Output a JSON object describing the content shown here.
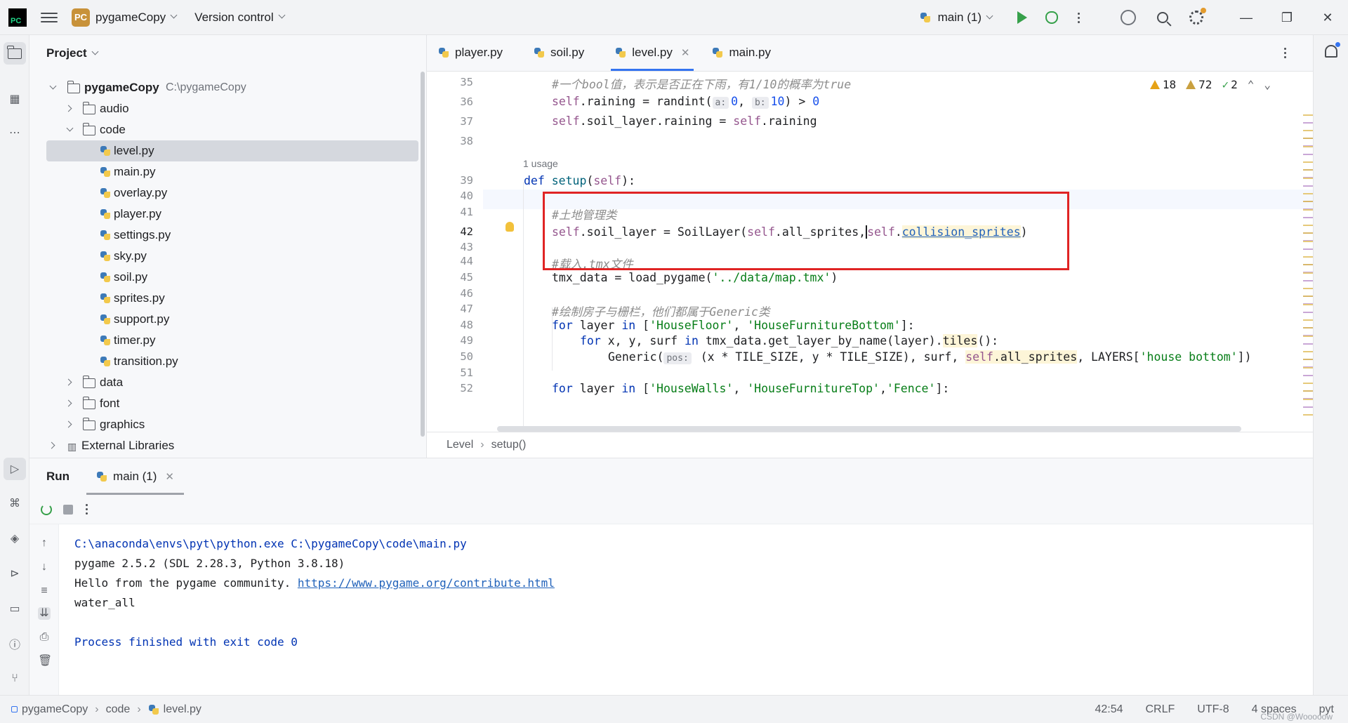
{
  "titlebar": {
    "project_badge": "PC",
    "project_name": "pygameCopy",
    "vcs": "Version control",
    "run_config": "main (1)"
  },
  "project_panel": {
    "title": "Project",
    "root": "pygameCopy",
    "root_path": "C:\\pygameCopy",
    "folders": [
      "audio",
      "code",
      "data",
      "font",
      "graphics"
    ],
    "code_files": [
      "level.py",
      "main.py",
      "overlay.py",
      "player.py",
      "settings.py",
      "sky.py",
      "soil.py",
      "sprites.py",
      "support.py",
      "timer.py",
      "transition.py"
    ],
    "external": "External Libraries"
  },
  "editor": {
    "tabs": [
      "player.py",
      "soil.py",
      "level.py",
      "main.py"
    ],
    "active_tab": "level.py",
    "inspections": {
      "warnings": "18",
      "weak_warnings": "72",
      "ok": "2"
    },
    "usage_hint": "1 usage",
    "line_numbers": [
      "35",
      "36",
      "37",
      "38",
      "39",
      "40",
      "41",
      "42",
      "43",
      "44",
      "45",
      "46",
      "47",
      "48",
      "49",
      "50",
      "51",
      "52"
    ],
    "code": {
      "l35": "#一个bool值，表示是否正在下雨，有1/10的概率为true",
      "l36_a": "self",
      "l36_b": ".raining = randint(",
      "l36_h1": "a:",
      "l36_n1": "0",
      "l36_c": ", ",
      "l36_h2": "b:",
      "l36_n2": "10",
      "l36_d": ") > ",
      "l36_n3": "0",
      "l37_a": "self",
      "l37_b": ".soil_layer.raining = ",
      "l37_c": "self",
      "l37_d": ".raining",
      "l39_kw": "def ",
      "l39_fn": "setup",
      "l39_p": "(",
      "l39_self": "self",
      "l39_e": "):",
      "l41": "#土地管理类",
      "l42_a": "self",
      "l42_b": ".soil_layer = SoilLayer(",
      "l42_c": "self",
      "l42_d": ".all_sprites,",
      "l42_e": "self",
      "l42_f": ".",
      "l42_g": "collision_sprites",
      "l42_h": ")",
      "l44": "#载入.tmx文件",
      "l45_a": "tmx_data = load_pygame(",
      "l45_s": "'../data/map.tmx'",
      "l45_b": ")",
      "l47": "#绘制房子与栅栏，他们都属于Generic类",
      "l48_kw": "for ",
      "l48_a": "layer ",
      "l48_in": "in ",
      "l48_b": "[",
      "l48_s1": "'HouseFloor'",
      "l48_c": ", ",
      "l48_s2": "'HouseFurnitureBottom'",
      "l48_d": "]:",
      "l49_kw": "for ",
      "l49_a": "x, y, surf ",
      "l49_in": "in ",
      "l49_b": "tmx_data.get_layer_by_name(layer).",
      "l49_t": "tiles",
      "l49_c": "():",
      "l50_a": "Generic(",
      "l50_h": "pos:",
      "l50_b": " (x * TILE_SIZE, y * TILE_SIZE), surf, ",
      "l50_self": "self",
      "l50_c": ".all_sprites",
      "l50_d": ", LAYERS[",
      "l50_s": "'house bottom'",
      "l50_e": "])",
      "l52_kw": "for ",
      "l52_a": "layer ",
      "l52_in": "in ",
      "l52_b": "[",
      "l52_s1": "'HouseWalls'",
      "l52_c": ", ",
      "l52_s2": "'HouseFurnitureTop'",
      "l52_c2": ",",
      "l52_s3": "'Fence'",
      "l52_d": "]:"
    },
    "breadcrumb": [
      "Level",
      "setup()"
    ]
  },
  "run_panel": {
    "title": "Run",
    "tab": "main (1)",
    "console": {
      "line1": "C:\\anaconda\\envs\\pyt\\python.exe C:\\pygameCopy\\code\\main.py",
      "line2": "pygame 2.5.2 (SDL 2.28.3, Python 3.8.18)",
      "line3_a": "Hello from the pygame community. ",
      "line3_link": "https://www.pygame.org/contribute.html",
      "line4": "water_all",
      "line5": "Process finished with exit code 0"
    }
  },
  "statusbar": {
    "crumbs": [
      "pygameCopy",
      "code",
      "level.py"
    ],
    "position": "42:54",
    "line_sep": "CRLF",
    "encoding": "UTF-8",
    "indent": "4 spaces",
    "interpreter": "pyt",
    "watermark": "CSDN @Wooooow"
  },
  "colors": {
    "accent": "#3574f0",
    "keyword": "#0033b3",
    "self": "#94558d",
    "string": "#067d17",
    "number": "#1750eb",
    "highlight_box": "#e02424"
  }
}
